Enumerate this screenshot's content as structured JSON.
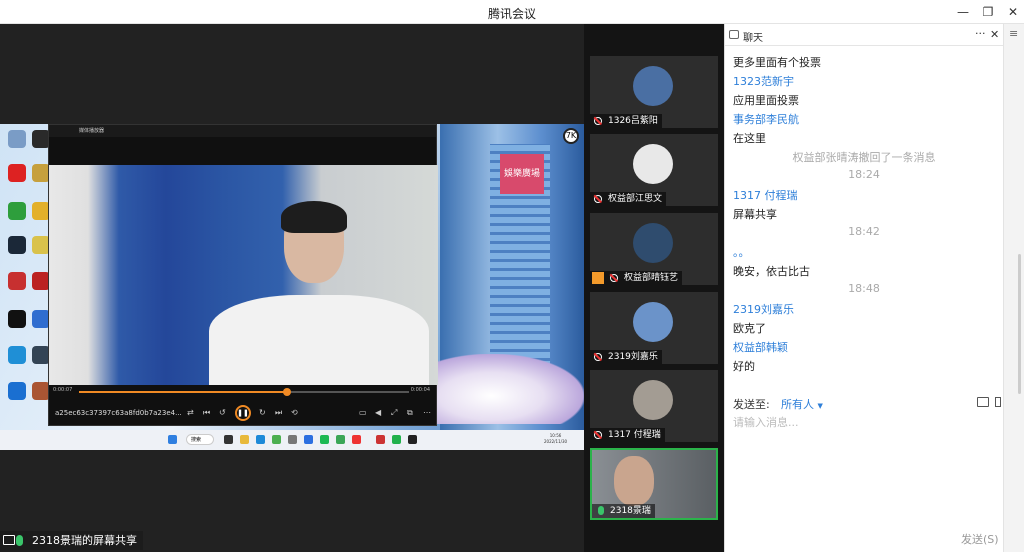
{
  "window": {
    "title": "腾讯会议",
    "btn_min": "—",
    "btn_restore": "❐",
    "btn_close": "✕"
  },
  "share": {
    "label": "2318景瑞的屏幕共享"
  },
  "player": {
    "title": "媒体播放器",
    "filename": "a25ec63c37397c63a8fd0b7a23e4...",
    "time_current": "0:00:07",
    "time_total": "0:00:04",
    "progress": 0.63
  },
  "taskbar": {
    "search": "搜索",
    "time": "10:56",
    "date": "2022/11/30"
  },
  "desktop": {
    "sign_text": "娛樂廣場",
    "logo": "7K"
  },
  "participants": [
    {
      "name": "1326吕紫阳",
      "avatar_color": "#4a6fa3"
    },
    {
      "name": "权益部江思文",
      "avatar_color": "#e8e8e8"
    },
    {
      "name": "权益部晴钰艺",
      "avatar_color": "#2f4c6e"
    },
    {
      "name": "2319刘嘉乐",
      "avatar_color": "#6b93c9"
    },
    {
      "name": "1317 付程瑞",
      "avatar_color": "#a39c93"
    },
    {
      "name": "2318景瑞",
      "avatar_color": "#6b6f72"
    }
  ],
  "chat": {
    "title": "聊天",
    "more": "···",
    "close": "✕",
    "menu": "≡",
    "messages": [
      {
        "kind": "text",
        "text": "更多里面有个投票"
      },
      {
        "kind": "sender",
        "text": "1323范新宇"
      },
      {
        "kind": "text",
        "text": "应用里面投票"
      },
      {
        "kind": "sender",
        "text": "事务部李民航"
      },
      {
        "kind": "text",
        "text": "在这里"
      },
      {
        "kind": "system",
        "text": "权益部张晴涛撤回了一条消息"
      },
      {
        "kind": "time",
        "text": "18:24"
      },
      {
        "kind": "sender",
        "text": "1317 付程瑞"
      },
      {
        "kind": "text",
        "text": "屏幕共享"
      },
      {
        "kind": "time",
        "text": "18:42"
      },
      {
        "kind": "sender",
        "text": "。。"
      },
      {
        "kind": "text",
        "text": "晚安，依古比古"
      },
      {
        "kind": "time",
        "text": "18:48"
      },
      {
        "kind": "sender",
        "text": "2319刘嘉乐"
      },
      {
        "kind": "text",
        "text": "欧克了"
      },
      {
        "kind": "sender",
        "text": "权益部韩颖"
      },
      {
        "kind": "text",
        "text": "好的"
      }
    ],
    "send_to_label": "发送至:",
    "send_to_value": "所有人",
    "input_placeholder": "请输入消息...",
    "send_button": "发送(S)"
  }
}
